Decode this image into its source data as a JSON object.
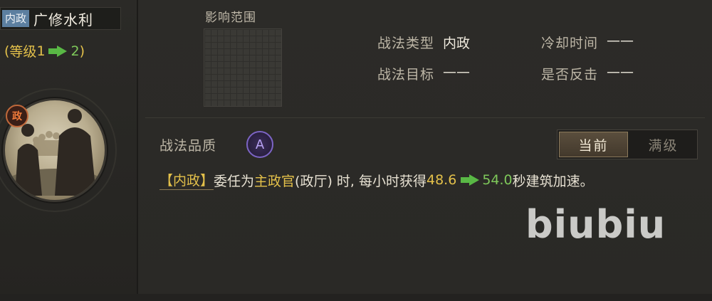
{
  "tactic": {
    "type_tag": "内政",
    "name": "广修水利",
    "level_open": "(",
    "level_prefix": "等级",
    "level_from": "1",
    "level_to": "2",
    "level_close": ")"
  },
  "portrait": {
    "faction_badge": "政"
  },
  "area": {
    "label": "影响范围"
  },
  "info": {
    "type_label": "战法类型",
    "type_value": "内政",
    "cooldown_label": "冷却时间",
    "cooldown_value": "——",
    "target_label": "战法目标",
    "target_value": "——",
    "counter_label": "是否反击",
    "counter_value": "——"
  },
  "quality": {
    "label": "战法品质",
    "grade": "A"
  },
  "toggle": {
    "current": "当前",
    "max": "满级"
  },
  "description": {
    "tag": "【内政】",
    "part1": "委任为",
    "highlight": "主政官",
    "part2": "(政厅) 时, 每小时获得",
    "value_from": "48.6",
    "value_to": "54.0",
    "part3": "秒建筑加速。"
  },
  "watermark": "biubiu",
  "colors": {
    "gold": "#e3c04a",
    "green": "#7ec85a",
    "tag_blue": "#5c7fa0",
    "grade_purple": "#7c64c4"
  }
}
